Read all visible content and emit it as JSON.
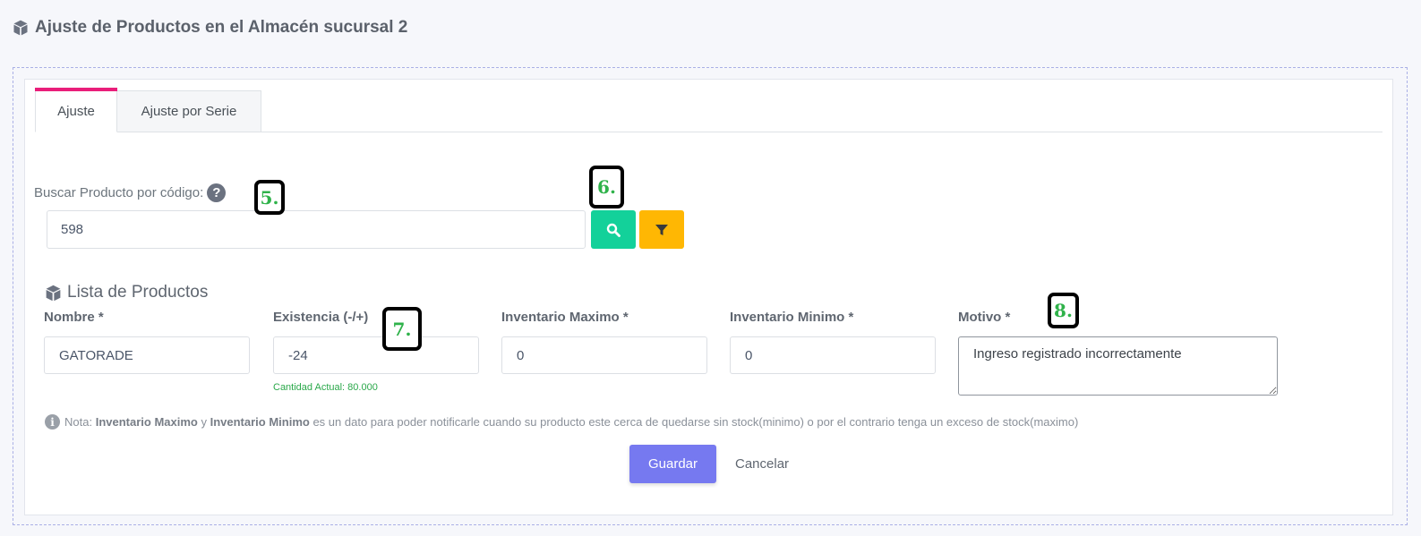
{
  "page": {
    "title": "Ajuste de Productos en el Almacén sucursal 2",
    "title_icon": "box-icon"
  },
  "tabs": [
    {
      "label": "Ajuste",
      "active": true
    },
    {
      "label": "Ajuste por Serie",
      "active": false
    }
  ],
  "search": {
    "label": "Buscar Producto por código:",
    "help_icon": "question-circle-icon",
    "value": "598",
    "search_button_icon": "search-icon",
    "filter_button_icon": "filter-icon"
  },
  "list": {
    "title": "Lista de Productos",
    "icon": "box-icon"
  },
  "fields": {
    "nombre": {
      "label": "Nombre *",
      "value": "GATORADE"
    },
    "existencia": {
      "label": "Existencia (-/+)",
      "value": "-24",
      "helper": "Cantidad Actual: 80.000"
    },
    "inventario_maximo": {
      "label": "Inventario Maximo *",
      "value": "0"
    },
    "inventario_minimo": {
      "label": "Inventario Minimo *",
      "value": "0"
    },
    "motivo": {
      "label": "Motivo *",
      "value": "Ingreso registrado incorrectamente"
    }
  },
  "note": {
    "prefix": "Nota:",
    "bold1": "Inventario Maximo",
    "mid": "y",
    "bold2": "Inventario Minimo",
    "rest": "es un dato para poder notificarle cuando su producto este cerca de quedarse sin stock(minimo) o por el contrario tenga un exceso de stock(maximo)"
  },
  "actions": {
    "save": "Guardar",
    "cancel": "Cancelar"
  },
  "annotations": [
    "5.",
    "6.",
    "7.",
    "8."
  ],
  "colors": {
    "tab_accent": "#e91e7a",
    "search_button": "#13d19a",
    "filter_button": "#ffb703",
    "save_button": "#7679f0",
    "helper_text": "#2aa84a"
  }
}
